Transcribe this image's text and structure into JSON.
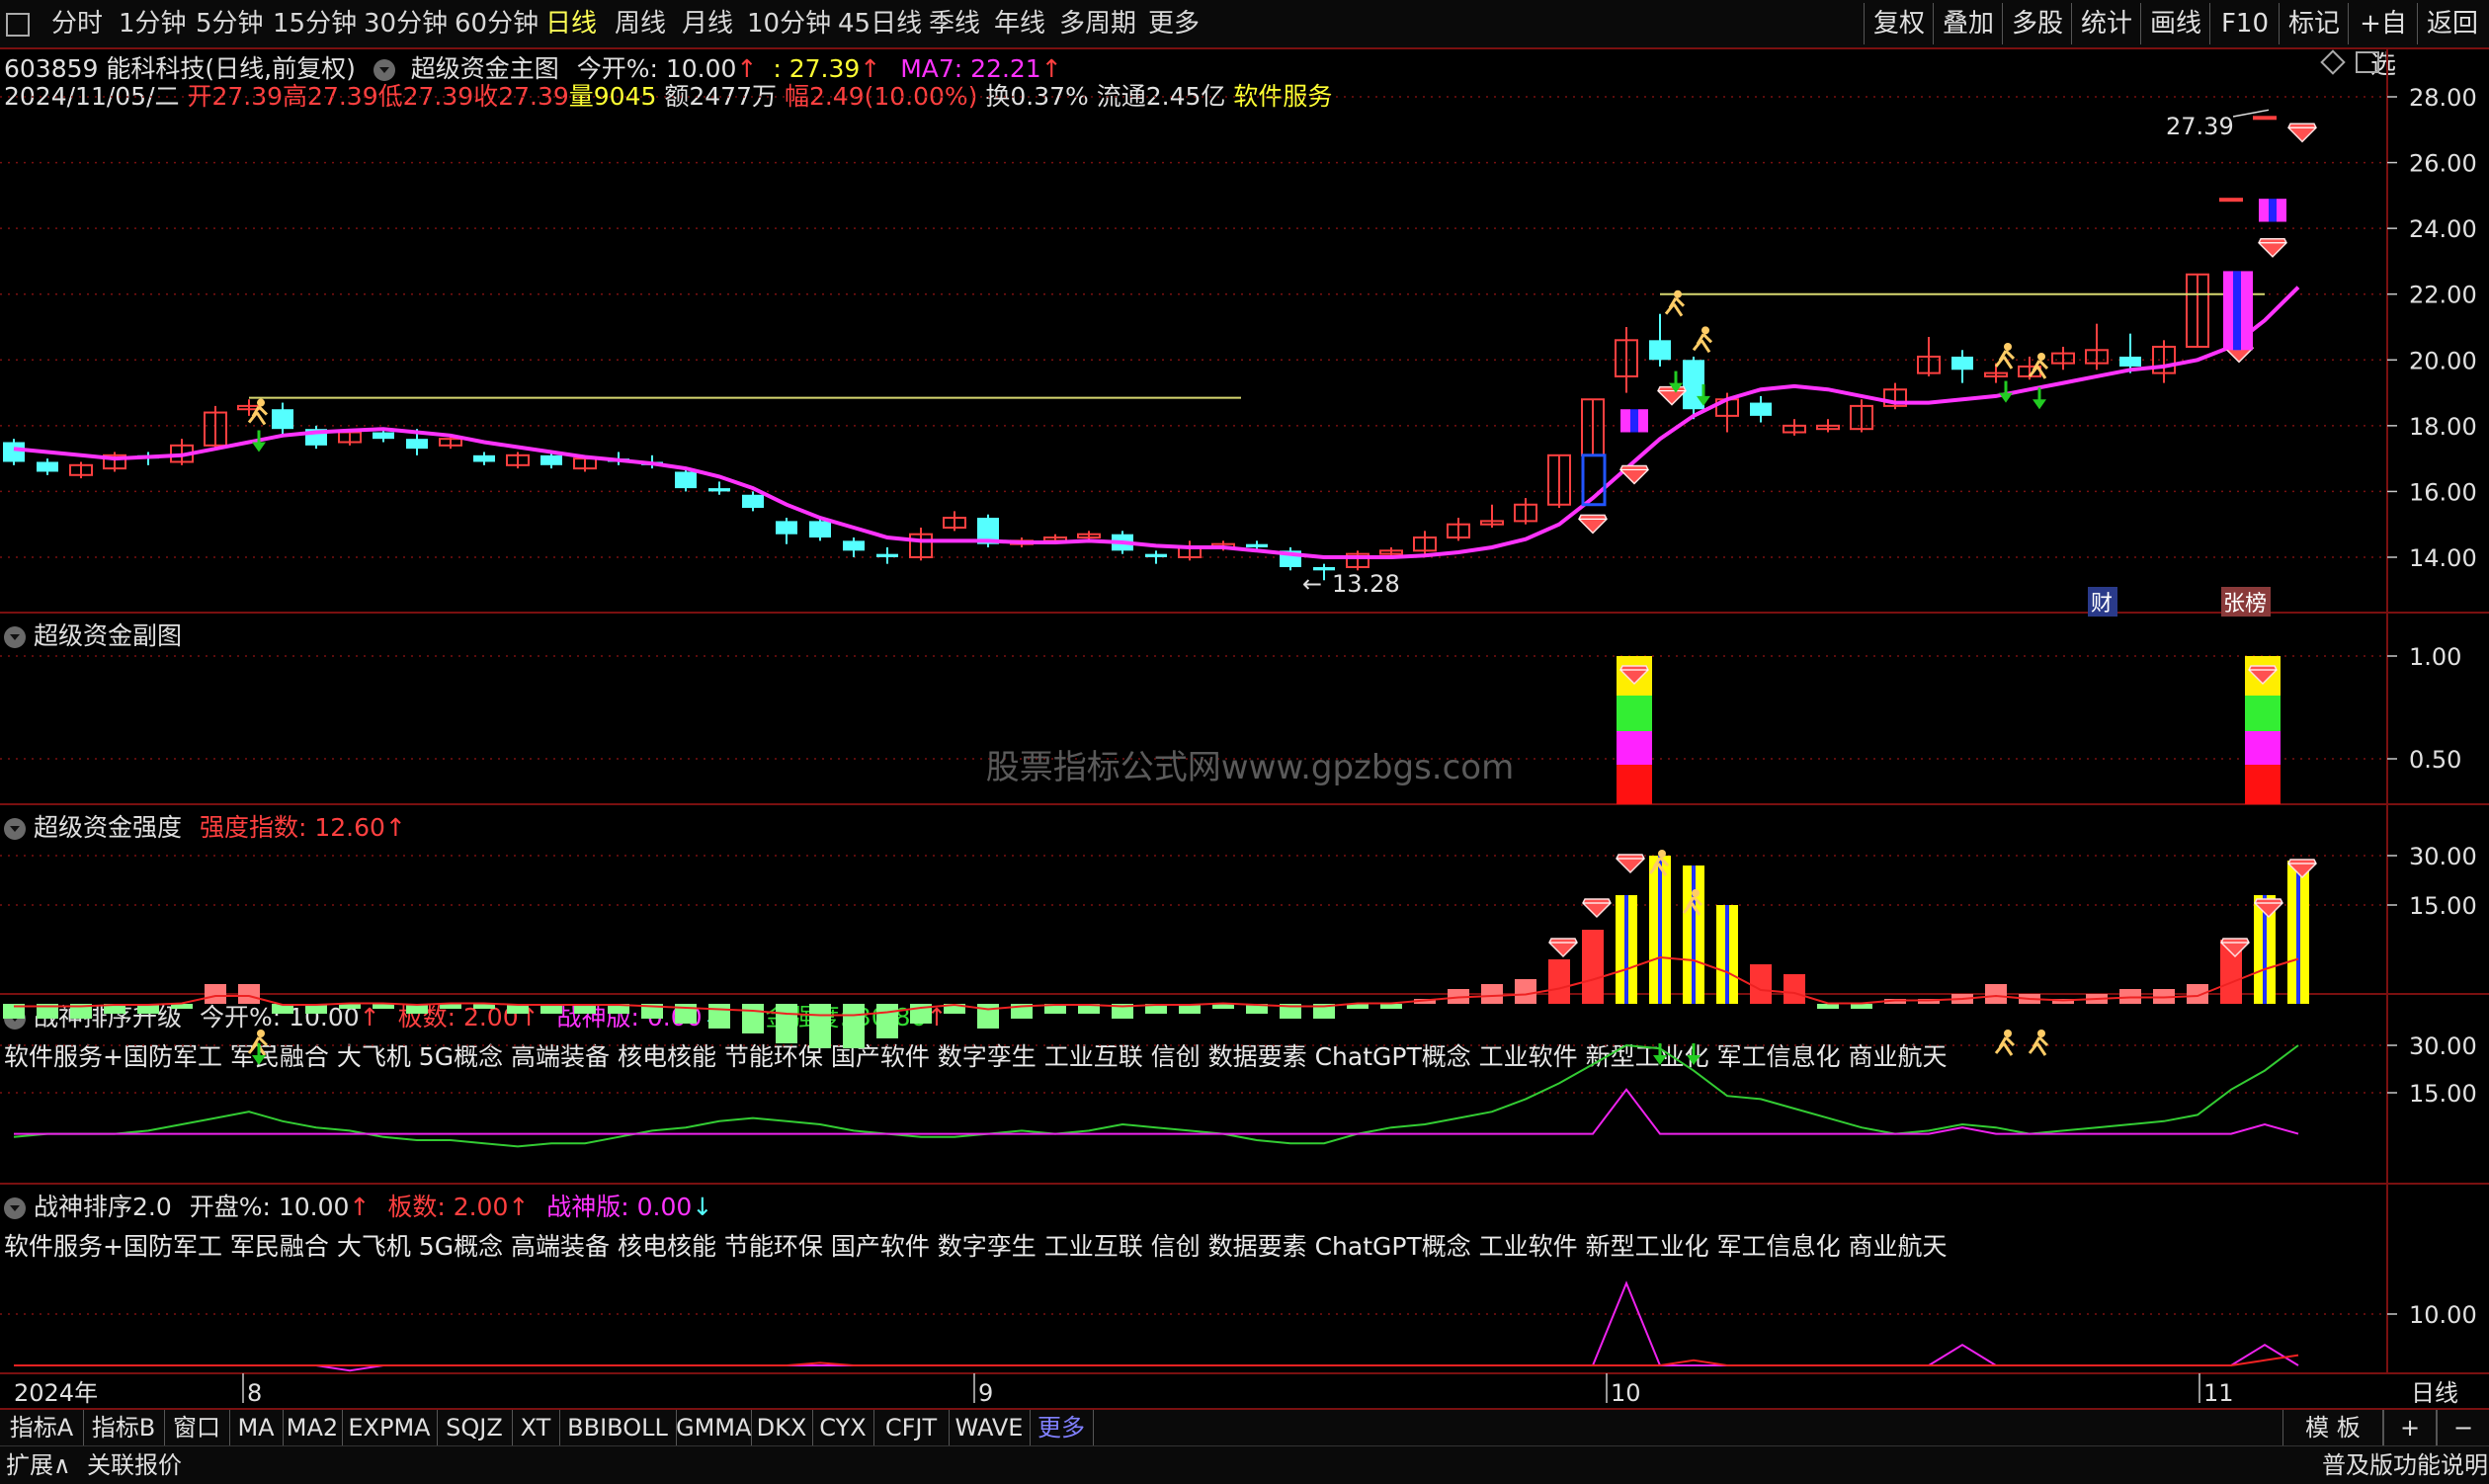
{
  "toolbar": {
    "left": [
      "分时",
      "1分钟",
      "5分钟",
      "15分钟",
      "30分钟",
      "60分钟",
      "日线",
      "周线",
      "月线",
      "10分钟",
      "45日线",
      "季线",
      "年线",
      "多周期",
      "更多"
    ],
    "active": "日线",
    "right": [
      "复权",
      "叠加",
      "多股",
      "统计",
      "画线",
      "F10",
      "标记",
      "+自选",
      "返回"
    ]
  },
  "stock": {
    "title": "603859 能科科技(日线,前复权)",
    "indicator": "超级资金主图",
    "today_open_label": "今开%: 10.00",
    "price_label": ": 27.39",
    "ma7_label": "MA7: 22.21",
    "date": "2024/11/05/二",
    "open": "开27.39",
    "high": "高27.39",
    "low": "低27.39",
    "close": "收27.39",
    "volume": "量9045",
    "amount": "额2477万",
    "change": "幅2.49(10.00%)",
    "turnover": "换0.37%",
    "float": "流通2.45亿",
    "sector": "软件服务",
    "last_price_label": "27.39",
    "low_label": "13.28",
    "badge_cai": "财",
    "badge_zb": "张榜"
  },
  "main_axis": [
    "28.00",
    "26.00",
    "24.00",
    "22.00",
    "20.00",
    "18.00",
    "16.00",
    "14.00"
  ],
  "panel2": {
    "title": "超级资金副图",
    "axis": [
      "1.00",
      "0.50"
    ]
  },
  "panel3": {
    "title": "超级资金强度",
    "index_label": "强度指数: 12.60",
    "axis": [
      "30.00",
      "15.00"
    ]
  },
  "panel4": {
    "title": "战神排序升级",
    "open_label": "今开%: 10.00",
    "board_label": "板数: 2.00",
    "god_label": "战神版: 0.00",
    "strength_label": "资金强度: 30.86",
    "axis": [
      "30.00",
      "15.00"
    ]
  },
  "panel5": {
    "title": "战神排序2.0",
    "open_label": "开盘%: 10.00",
    "board_label": "板数: 2.00",
    "god_label": "战神版: 0.00",
    "axis": [
      "10.00"
    ]
  },
  "concepts": "软件服务+国防军工 军民融合 大飞机 5G概念 高端装备 核电核能 节能环保 国产软件 数字孪生 工业互联 信创 数据要素 ChatGPT概念 工业软件 新型工业化 军工信息化 商业航天",
  "watermark": "股票指标公式网www.gpzbgs.com",
  "time_axis": {
    "year": "2024年",
    "months": [
      "8",
      "9",
      "10",
      "11"
    ],
    "period": "日线"
  },
  "bottom_tabs": [
    "指标A",
    "指标B",
    "窗口",
    "MA",
    "MA2",
    "EXPMA",
    "SQJZ",
    "XT",
    "BBIBOLL",
    "GMMA",
    "DKX",
    "CYX",
    "CFJT",
    "WAVE",
    "更多"
  ],
  "bottom_right": [
    "模 板",
    "+",
    "−"
  ],
  "status": {
    "expand": "扩展∧",
    "related": "关联报价",
    "right": "普及版功能说明"
  },
  "colors": {
    "up": "#ff4040",
    "down": "#55ffff",
    "ma": "#ff33ff",
    "yellow": "#ffff00",
    "green": "#33dd33",
    "grid": "#7a1010"
  },
  "chart_data": {
    "type": "candlestick",
    "ylim": [
      13,
      29
    ],
    "ma_label": "MA7",
    "candles": [
      {
        "o": 17.5,
        "c": 16.9,
        "h": 17.6,
        "l": 16.8
      },
      {
        "o": 16.9,
        "c": 16.6,
        "h": 17.0,
        "l": 16.5
      },
      {
        "o": 16.5,
        "c": 16.8,
        "h": 16.9,
        "l": 16.4
      },
      {
        "o": 16.7,
        "c": 17.1,
        "h": 17.2,
        "l": 16.6
      },
      {
        "o": 17.1,
        "c": 17.0,
        "h": 17.2,
        "l": 16.8
      },
      {
        "o": 16.9,
        "c": 17.4,
        "h": 17.6,
        "l": 16.8
      },
      {
        "o": 17.4,
        "c": 18.4,
        "h": 18.6,
        "l": 17.3
      },
      {
        "o": 18.5,
        "c": 18.6,
        "h": 18.8,
        "l": 18.3
      },
      {
        "o": 18.5,
        "c": 17.9,
        "h": 18.7,
        "l": 17.7
      },
      {
        "o": 17.9,
        "c": 17.4,
        "h": 18.0,
        "l": 17.3
      },
      {
        "o": 17.5,
        "c": 17.8,
        "h": 17.9,
        "l": 17.4
      },
      {
        "o": 17.8,
        "c": 17.6,
        "h": 17.9,
        "l": 17.5
      },
      {
        "o": 17.6,
        "c": 17.3,
        "h": 17.9,
        "l": 17.1
      },
      {
        "o": 17.4,
        "c": 17.6,
        "h": 17.7,
        "l": 17.3
      },
      {
        "o": 17.1,
        "c": 16.9,
        "h": 17.2,
        "l": 16.8
      },
      {
        "o": 16.8,
        "c": 17.1,
        "h": 17.2,
        "l": 16.7
      },
      {
        "o": 17.1,
        "c": 16.8,
        "h": 17.2,
        "l": 16.7
      },
      {
        "o": 16.7,
        "c": 17.0,
        "h": 17.1,
        "l": 16.6
      },
      {
        "o": 17.0,
        "c": 16.9,
        "h": 17.2,
        "l": 16.8
      },
      {
        "o": 16.9,
        "c": 16.8,
        "h": 17.1,
        "l": 16.7
      },
      {
        "o": 16.6,
        "c": 16.1,
        "h": 16.7,
        "l": 16.0
      },
      {
        "o": 16.1,
        "c": 16.0,
        "h": 16.3,
        "l": 15.9
      },
      {
        "o": 15.9,
        "c": 15.5,
        "h": 16.0,
        "l": 15.4
      },
      {
        "o": 15.1,
        "c": 14.7,
        "h": 15.2,
        "l": 14.4
      },
      {
        "o": 15.1,
        "c": 14.6,
        "h": 15.2,
        "l": 14.5
      },
      {
        "o": 14.5,
        "c": 14.2,
        "h": 14.6,
        "l": 14.0
      },
      {
        "o": 14.1,
        "c": 14.0,
        "h": 14.3,
        "l": 13.8
      },
      {
        "o": 14.0,
        "c": 14.7,
        "h": 14.9,
        "l": 13.9
      },
      {
        "o": 14.9,
        "c": 15.2,
        "h": 15.4,
        "l": 14.8
      },
      {
        "o": 15.2,
        "c": 14.4,
        "h": 15.3,
        "l": 14.3
      },
      {
        "o": 14.4,
        "c": 14.5,
        "h": 14.6,
        "l": 14.3
      },
      {
        "o": 14.5,
        "c": 14.6,
        "h": 14.7,
        "l": 14.4
      },
      {
        "o": 14.6,
        "c": 14.7,
        "h": 14.8,
        "l": 14.5
      },
      {
        "o": 14.7,
        "c": 14.2,
        "h": 14.8,
        "l": 14.1
      },
      {
        "o": 14.1,
        "c": 14.0,
        "h": 14.2,
        "l": 13.8
      },
      {
        "o": 14.0,
        "c": 14.3,
        "h": 14.5,
        "l": 13.9
      },
      {
        "o": 14.3,
        "c": 14.4,
        "h": 14.5,
        "l": 14.2
      },
      {
        "o": 14.4,
        "c": 14.3,
        "h": 14.5,
        "l": 14.2
      },
      {
        "o": 14.2,
        "c": 13.7,
        "h": 14.3,
        "l": 13.6
      },
      {
        "o": 13.7,
        "c": 13.6,
        "h": 13.8,
        "l": 13.3
      },
      {
        "o": 13.7,
        "c": 14.1,
        "h": 14.2,
        "l": 13.6
      },
      {
        "o": 14.1,
        "c": 14.2,
        "h": 14.3,
        "l": 14.0
      },
      {
        "o": 14.2,
        "c": 14.6,
        "h": 14.8,
        "l": 14.1
      },
      {
        "o": 14.6,
        "c": 15.0,
        "h": 15.2,
        "l": 14.5
      },
      {
        "o": 15.0,
        "c": 15.1,
        "h": 15.6,
        "l": 14.9
      },
      {
        "o": 15.1,
        "c": 15.6,
        "h": 15.8,
        "l": 15.0
      },
      {
        "o": 15.6,
        "c": 17.1,
        "h": 17.1,
        "l": 15.5
      },
      {
        "o": 17.1,
        "c": 18.8,
        "h": 18.8,
        "l": 17.1
      },
      {
        "o": 19.5,
        "c": 20.6,
        "h": 21.0,
        "l": 19.0
      },
      {
        "o": 20.6,
        "c": 20.0,
        "h": 21.4,
        "l": 19.8
      },
      {
        "o": 20.0,
        "c": 18.5,
        "h": 20.1,
        "l": 18.2
      },
      {
        "o": 18.3,
        "c": 18.8,
        "h": 19.0,
        "l": 17.8
      },
      {
        "o": 18.7,
        "c": 18.3,
        "h": 18.9,
        "l": 18.1
      },
      {
        "o": 17.8,
        "c": 18.0,
        "h": 18.2,
        "l": 17.7
      },
      {
        "o": 17.9,
        "c": 18.0,
        "h": 18.2,
        "l": 17.8
      },
      {
        "o": 17.9,
        "c": 18.6,
        "h": 18.8,
        "l": 17.8
      },
      {
        "o": 18.6,
        "c": 19.1,
        "h": 19.3,
        "l": 18.5
      },
      {
        "o": 19.6,
        "c": 20.1,
        "h": 20.7,
        "l": 19.5
      },
      {
        "o": 20.1,
        "c": 19.7,
        "h": 20.3,
        "l": 19.3
      },
      {
        "o": 19.5,
        "c": 19.6,
        "h": 19.9,
        "l": 19.3
      },
      {
        "o": 19.5,
        "c": 19.8,
        "h": 20.1,
        "l": 19.4
      },
      {
        "o": 19.9,
        "c": 20.2,
        "h": 20.4,
        "l": 19.7
      },
      {
        "o": 19.9,
        "c": 20.3,
        "h": 21.1,
        "l": 19.7
      },
      {
        "o": 20.1,
        "c": 19.8,
        "h": 20.8,
        "l": 19.6
      },
      {
        "o": 19.6,
        "c": 20.4,
        "h": 20.6,
        "l": 19.3
      },
      {
        "o": 20.4,
        "c": 22.6,
        "h": 22.6,
        "l": 20.4
      },
      {
        "o": 24.9,
        "c": 24.9,
        "h": 24.9,
        "l": 24.9
      },
      {
        "o": 27.39,
        "c": 27.39,
        "h": 27.39,
        "l": 27.39
      }
    ],
    "ma7": [
      17.3,
      17.2,
      17.1,
      17.0,
      17.05,
      17.1,
      17.3,
      17.5,
      17.7,
      17.8,
      17.85,
      17.9,
      17.8,
      17.7,
      17.5,
      17.35,
      17.2,
      17.05,
      16.95,
      16.85,
      16.7,
      16.45,
      16.1,
      15.6,
      15.2,
      14.9,
      14.6,
      14.5,
      14.5,
      14.5,
      14.45,
      14.45,
      14.5,
      14.45,
      14.35,
      14.3,
      14.3,
      14.2,
      14.1,
      14.0,
      14.0,
      14.0,
      14.05,
      14.15,
      14.3,
      14.55,
      15.0,
      15.8,
      16.7,
      17.6,
      18.3,
      18.8,
      19.1,
      19.2,
      19.1,
      18.9,
      18.7,
      18.7,
      18.8,
      18.9,
      19.1,
      19.3,
      19.5,
      19.7,
      19.8,
      20.0,
      20.4,
      21.2,
      22.21
    ],
    "panel3_values": [
      -3,
      -3,
      -3,
      -2,
      -2,
      -1,
      4,
      4,
      -2,
      -2,
      -1,
      -1,
      -2,
      -1,
      -1,
      -2,
      -2,
      -2,
      -2,
      -3,
      -4,
      -5,
      -6,
      -8,
      -9,
      -9,
      -7,
      -4,
      -2,
      -5,
      -3,
      -2,
      -2,
      -3,
      -2,
      -2,
      -1,
      -2,
      -3,
      -3,
      -1,
      -1,
      1,
      3,
      4,
      5,
      9,
      15,
      22,
      30,
      28,
      20,
      8,
      6,
      -1,
      -1,
      1,
      1,
      2,
      4,
      2,
      1,
      2,
      3,
      3,
      4,
      13,
      22,
      29
    ],
    "panel2_bars_at": [
      48,
      67
    ],
    "panel4_green": [
      1,
      2,
      2,
      2,
      3,
      5,
      7,
      9,
      6,
      4,
      3,
      1,
      0,
      0,
      -1,
      -2,
      -1,
      -1,
      1,
      3,
      4,
      6,
      7,
      6,
      5,
      3,
      2,
      1,
      1,
      2,
      3,
      2,
      3,
      5,
      4,
      3,
      2,
      0,
      -1,
      -1,
      2,
      4,
      5,
      7,
      9,
      13,
      18,
      24,
      30,
      29,
      22,
      14,
      13,
      10,
      7,
      4,
      2,
      3,
      5,
      4,
      2,
      3,
      4,
      5,
      6,
      8,
      16,
      22,
      30
    ],
    "panel4_pink": [
      2,
      2,
      2,
      2,
      2,
      2,
      2,
      2,
      2,
      2,
      2,
      2,
      2,
      2,
      2,
      2,
      2,
      2,
      2,
      2,
      2,
      2,
      2,
      2,
      2,
      2,
      2,
      2,
      2,
      2,
      2,
      2,
      2,
      2,
      2,
      2,
      2,
      2,
      2,
      2,
      2,
      2,
      2,
      2,
      2,
      2,
      2,
      2,
      16,
      2,
      2,
      2,
      2,
      2,
      2,
      2,
      2,
      2,
      4,
      2,
      2,
      2,
      2,
      2,
      2,
      2,
      2,
      5,
      2
    ],
    "panel5_pink": [
      0,
      0,
      0,
      0,
      0,
      0,
      0,
      0,
      0,
      0,
      -1,
      0,
      0,
      0,
      0,
      0,
      0,
      0,
      0,
      0,
      0,
      0,
      0,
      0,
      0,
      0,
      0,
      0,
      0,
      0,
      0,
      0,
      0,
      0,
      0,
      0,
      0,
      0,
      0,
      0,
      0,
      0,
      0,
      0,
      0,
      0,
      0,
      0,
      16,
      0,
      0,
      0,
      0,
      0,
      0,
      0,
      0,
      0,
      4,
      0,
      0,
      0,
      0,
      0,
      0,
      0,
      0,
      4,
      0
    ],
    "panel5_red": [
      0,
      0,
      0,
      0,
      0,
      0,
      0,
      0,
      0,
      0,
      0,
      0,
      0,
      0,
      0,
      0,
      0,
      0,
      0,
      0,
      0,
      0,
      0,
      0,
      0.5,
      0,
      0,
      0,
      0,
      0,
      0,
      0,
      0,
      0,
      0,
      0,
      0,
      0,
      0,
      0,
      0,
      0,
      0,
      0,
      0,
      0,
      0,
      0,
      0,
      0,
      1,
      0,
      0,
      0,
      0,
      0,
      0,
      0,
      0,
      0,
      0,
      0,
      0,
      0,
      0,
      0,
      0,
      1,
      2
    ]
  }
}
